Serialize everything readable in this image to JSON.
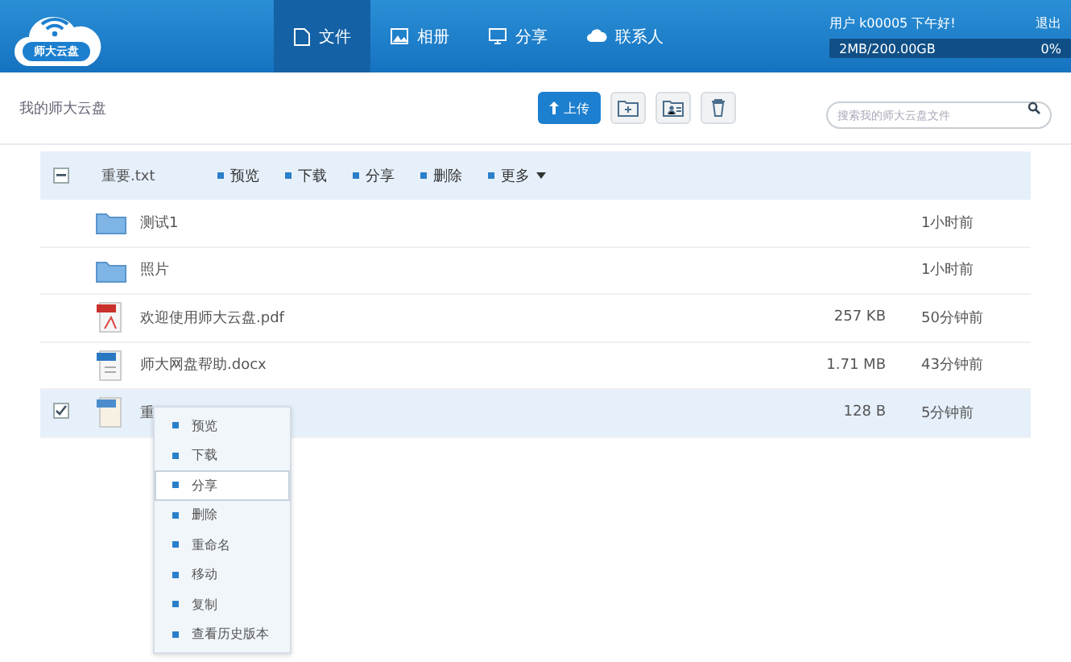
{
  "header": {
    "logo_text": "师大云盘",
    "nav": [
      {
        "label": "文件",
        "selected": true
      },
      {
        "label": "相册",
        "selected": false
      },
      {
        "label": "分享",
        "selected": false
      },
      {
        "label": "联系人",
        "selected": false
      }
    ],
    "greeting": "用户 k00005 下午好!",
    "logout": "退出",
    "storage": {
      "text": "2MB/200.00GB",
      "percent": "0%",
      "level": 0.0
    }
  },
  "toolbar": {
    "breadcrumb": "我的师大云盘",
    "upload": "上传",
    "search": {
      "placeholder": "搜索我的师大云盘文件"
    }
  },
  "selection_bar": {
    "partial": true,
    "name": "重要.txt",
    "actions": [
      "预览",
      "下载",
      "分享",
      "删除"
    ],
    "more": "更多"
  },
  "rows": [
    {
      "kind": "folder",
      "name": "测试1",
      "size": "",
      "time": "1小时前",
      "checked": false
    },
    {
      "kind": "folder",
      "name": "照片",
      "size": "",
      "time": "1小时前",
      "checked": false
    },
    {
      "kind": "pdf",
      "name": "欢迎使用师大云盘.pdf",
      "size": "257 KB",
      "time": "50分钟前",
      "checked": false
    },
    {
      "kind": "doc",
      "name": "师大网盘帮助.docx",
      "size": "1.71 MB",
      "time": "43分钟前",
      "checked": false
    },
    {
      "kind": "txt",
      "name": "重",
      "size": "128 B",
      "time": "5分钟前",
      "checked": true
    }
  ],
  "context_menu": [
    {
      "label": "预览",
      "selected": false
    },
    {
      "label": "下载",
      "selected": false
    },
    {
      "label": "分享",
      "selected": true
    },
    {
      "label": "删除",
      "selected": false
    },
    {
      "label": "重命名",
      "selected": false
    },
    {
      "label": "移动",
      "selected": false
    },
    {
      "label": "复制",
      "selected": false
    },
    {
      "label": "查看历史版本",
      "selected": false
    }
  ]
}
